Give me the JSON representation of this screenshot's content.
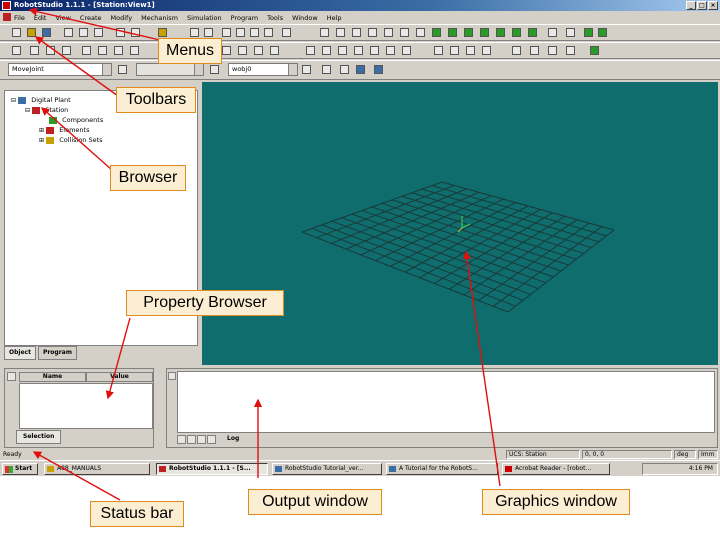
{
  "window": {
    "title": "RobotStudio 1.1.1 - [Station:View1]"
  },
  "menubar": {
    "items": [
      "File",
      "Edit",
      "View",
      "Create",
      "Modify",
      "Mechanism",
      "Simulation",
      "Program",
      "Tools",
      "Window",
      "Help"
    ]
  },
  "toolbar": {
    "motion_combo": "MoveJoint",
    "wobj_combo": "wobj0"
  },
  "browser": {
    "tree": [
      {
        "label": "Digital Plant",
        "level": 0,
        "icon": "plant-icon"
      },
      {
        "label": "Station",
        "level": 1,
        "icon": "station-icon"
      },
      {
        "label": "Components",
        "level": 2,
        "icon": "components-icon"
      },
      {
        "label": "Elements",
        "level": 2,
        "icon": "elements-icon"
      },
      {
        "label": "Collision Sets",
        "level": 2,
        "icon": "collision-sets-icon"
      }
    ],
    "tabs": [
      "Object",
      "Program"
    ]
  },
  "property_browser": {
    "columns": [
      "Name",
      "Value"
    ],
    "tab": "Selection"
  },
  "output_window": {
    "tab": "Log"
  },
  "statusbar": {
    "ready": "Ready",
    "ucs": "UCS: Station",
    "coords": "0, 0, 0",
    "unit": "deg",
    "mode": "Imm"
  },
  "taskbar": {
    "start": "Start",
    "items": [
      "A88_MANUALS",
      "RobotStudio 1.1.1 - [S...",
      "RobotStudio Tutorial_ver...",
      "A Tutorial for the RobotS...",
      "Acrobat Reader - [robot..."
    ],
    "clock": "4:16 PM"
  },
  "annotations": {
    "menus": "Menus",
    "toolbars": "Toolbars",
    "browser": "Browser",
    "property_browser": "Property Browser",
    "status_bar": "Status bar",
    "output_window": "Output window",
    "graphics_window": "Graphics window"
  },
  "colors": {
    "graphics_bg": "#0f6d6d",
    "grid": "#1a3a3a",
    "callout_bg": "#fbeed2",
    "callout_border": "#e08a1e",
    "arrow": "#e01010"
  }
}
